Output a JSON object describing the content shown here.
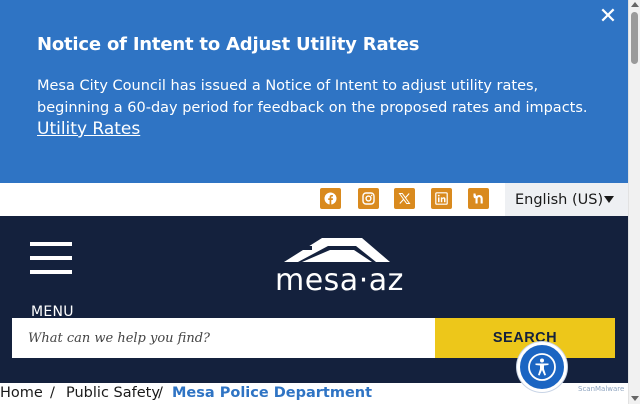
{
  "alert": {
    "title": "Notice of Intent to Adjust Utility Rates",
    "body": "Mesa City Council has issued a Notice of Intent to adjust utility rates, beginning a 60-day period for feedback on the proposed rates and impacts.",
    "link_label": "Utility Rates",
    "close_glyph": "✕",
    "background": "#2f74c4"
  },
  "social": {
    "icons": [
      "facebook-icon",
      "instagram-icon",
      "x-twitter-icon",
      "linkedin-icon",
      "nextdoor-icon"
    ],
    "color": "#d98a1e"
  },
  "language": {
    "selected": "English (US)"
  },
  "header": {
    "menu_label": "MENU",
    "logo_text": "mesa·az",
    "background": "#14213d"
  },
  "search": {
    "placeholder": "What can we help you find?",
    "button_label": "SEARCH",
    "button_color": "#edc71a"
  },
  "breadcrumb": {
    "items": [
      "Home",
      "Public Safety",
      "Mesa Police Department"
    ],
    "separator": "/"
  },
  "watermark": {
    "text": "ScanMalware"
  }
}
